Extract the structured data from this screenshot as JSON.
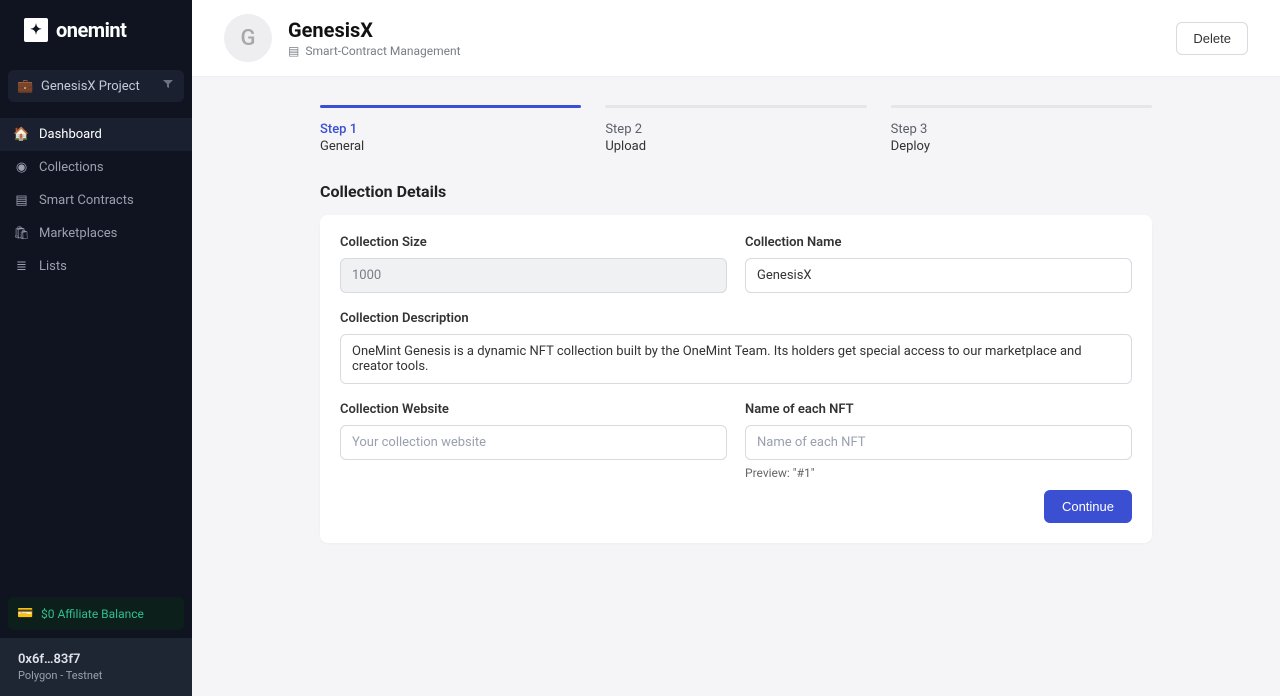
{
  "brand": {
    "name": "onemint",
    "logo_glyph": "✦"
  },
  "project_selector": {
    "label": "GenesisX Project"
  },
  "nav": {
    "items": [
      {
        "label": "Dashboard",
        "icon": "🏠",
        "active": true
      },
      {
        "label": "Collections",
        "icon": "◉"
      },
      {
        "label": "Smart Contracts",
        "icon": "▤"
      },
      {
        "label": "Marketplaces",
        "icon": "🛍"
      },
      {
        "label": "Lists",
        "icon": "≣"
      }
    ]
  },
  "affiliate": {
    "label": "$0 Affiliate Balance"
  },
  "wallet": {
    "address": "0x6f…83f7",
    "network": "Polygon - Testnet"
  },
  "header": {
    "avatar_letter": "G",
    "title": "GenesisX",
    "subtitle": "Smart-Contract Management",
    "delete_label": "Delete"
  },
  "steps": [
    {
      "label": "Step 1",
      "name": "General",
      "active": true
    },
    {
      "label": "Step 2",
      "name": "Upload"
    },
    {
      "label": "Step 3",
      "name": "Deploy"
    }
  ],
  "section": {
    "title": "Collection Details"
  },
  "form": {
    "size_label": "Collection Size",
    "size_value": "1000",
    "name_label": "Collection Name",
    "name_value": "GenesisX",
    "desc_label": "Collection Description",
    "desc_value": "OneMint Genesis is a dynamic NFT collection built by the OneMint Team. Its holders get special access to our marketplace and creator tools.",
    "website_label": "Collection Website",
    "website_placeholder": "Your collection website",
    "nftname_label": "Name of each NFT",
    "nftname_placeholder": "Name of each NFT",
    "preview_hint": "Preview: \"#1\"",
    "continue_label": "Continue"
  }
}
